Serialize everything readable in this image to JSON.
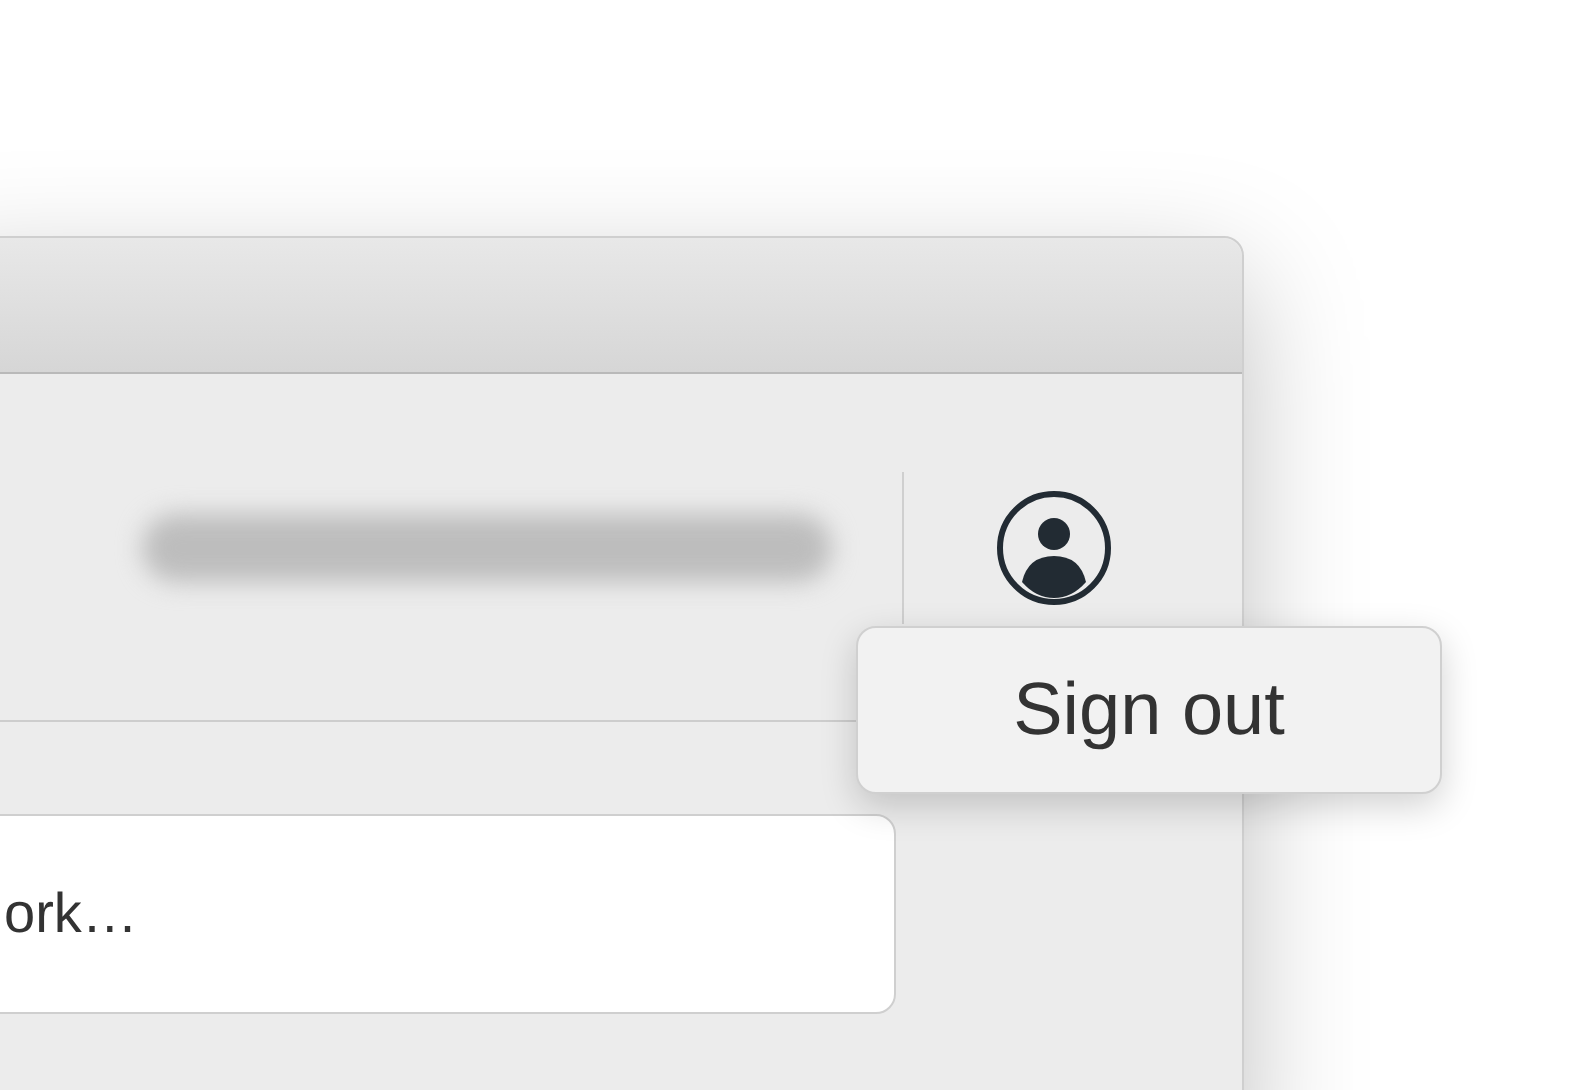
{
  "search": {
    "value": "ork…"
  },
  "account_menu": {
    "items": [
      {
        "label": "Sign out"
      }
    ]
  }
}
